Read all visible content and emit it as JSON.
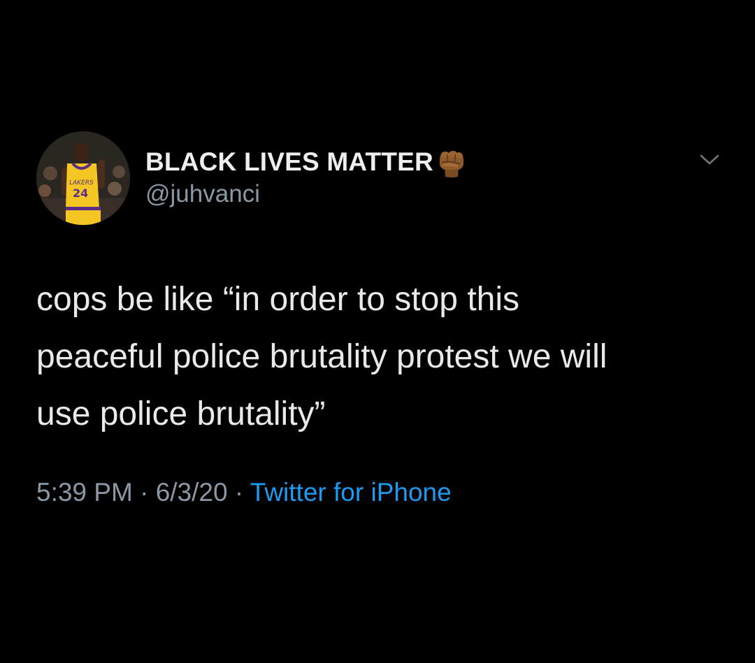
{
  "tweet": {
    "author": {
      "display_name": "BLACK LIVES MATTER",
      "name_emoji_icon": "raised-fist-icon",
      "handle": "@juhvanci",
      "avatar_icon": "avatar-photo",
      "avatar_jersey_number": "24",
      "avatar_jersey_text": "LAKERS"
    },
    "menu_icon": "chevron-down-icon",
    "text_lines": [
      "cops be like “in order to stop this",
      "peaceful police brutality protest we will",
      "use police brutality”"
    ],
    "meta": {
      "time": "5:39 PM",
      "separator_1": " · ",
      "date": "6/3/20",
      "separator_2": " · ",
      "source": "Twitter for iPhone"
    },
    "colors": {
      "background": "#000000",
      "text": "#e7e9ea",
      "muted": "#8b98a5",
      "link": "#1d9bf0",
      "emoji_skin": "#8d5a2b"
    }
  }
}
